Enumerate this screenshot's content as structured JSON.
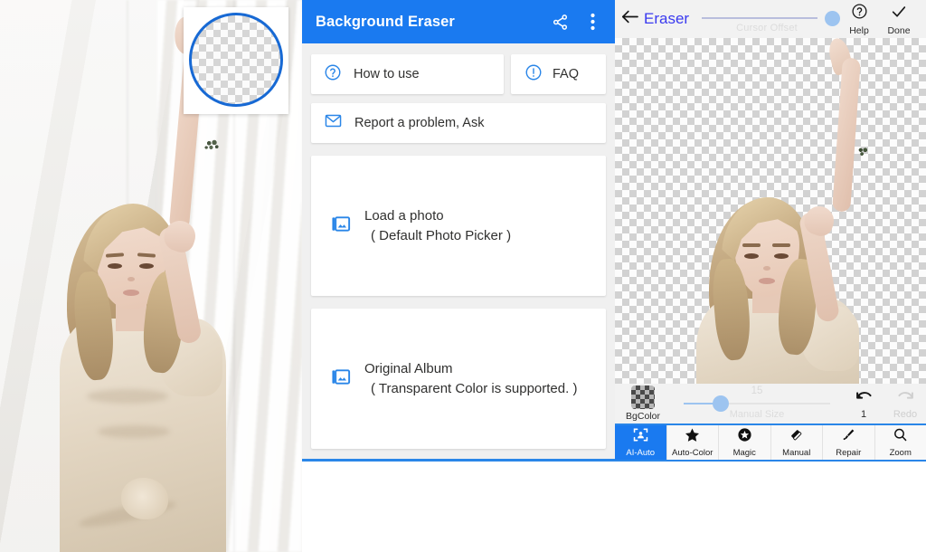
{
  "photo_panel": {
    "name": "photo-preview",
    "magnifier": {
      "name": "magnifier-circle-preview",
      "shape": "circle-outline-on-checkerboard"
    }
  },
  "menu_panel": {
    "appbar": {
      "title": "Background Eraser",
      "share_icon": "share-icon",
      "overflow_icon": "more-vert-icon",
      "bg_color": "#1a7af0"
    },
    "items": [
      {
        "label": "How to use",
        "icon": "help-circle-icon"
      },
      {
        "label": "FAQ",
        "icon": "exclamation-circle-icon"
      },
      {
        "label": "Report a problem, Ask",
        "icon": "mail-icon"
      }
    ],
    "big_cards": [
      {
        "title": "Load a photo",
        "subtitle": "( Default Photo Picker )",
        "icon": "photo-library-icon"
      },
      {
        "title": "Original Album",
        "subtitle": "( Transparent Color is supported. )",
        "icon": "photo-library-icon"
      }
    ],
    "accent_color": "#2a86e8"
  },
  "editor_panel": {
    "topbar": {
      "back_icon": "arrow-left-icon",
      "title": "Eraser",
      "slider": {
        "caption": "Cursor Offset",
        "position_percent": 96
      },
      "help": {
        "label": "Help",
        "icon": "help-circle-icon"
      },
      "done": {
        "label": "Done",
        "icon": "check-icon"
      }
    },
    "midbar": {
      "bgcolor": {
        "label": "BgColor",
        "icon": "checkerboard-swatch"
      },
      "manual_size": {
        "caption": "Manual Size",
        "value": "15",
        "position_percent": 16
      },
      "undo": {
        "label": "1",
        "icon": "undo-icon",
        "enabled": true
      },
      "redo": {
        "label": "Redo",
        "icon": "redo-icon",
        "enabled": false
      }
    },
    "tabs": [
      {
        "label": "AI-Auto",
        "icon": "face-focus-icon",
        "active": true
      },
      {
        "label": "Auto-Color",
        "icon": "star-icon",
        "active": false
      },
      {
        "label": "Magic",
        "icon": "magic-star-circle-icon",
        "active": false
      },
      {
        "label": "Manual",
        "icon": "eraser-icon",
        "active": false
      },
      {
        "label": "Repair",
        "icon": "brush-icon",
        "active": false
      },
      {
        "label": "Zoom",
        "icon": "magnifier-icon",
        "active": false
      }
    ],
    "canvas": {
      "name": "transparent-canvas",
      "background": "checkerboard"
    }
  }
}
